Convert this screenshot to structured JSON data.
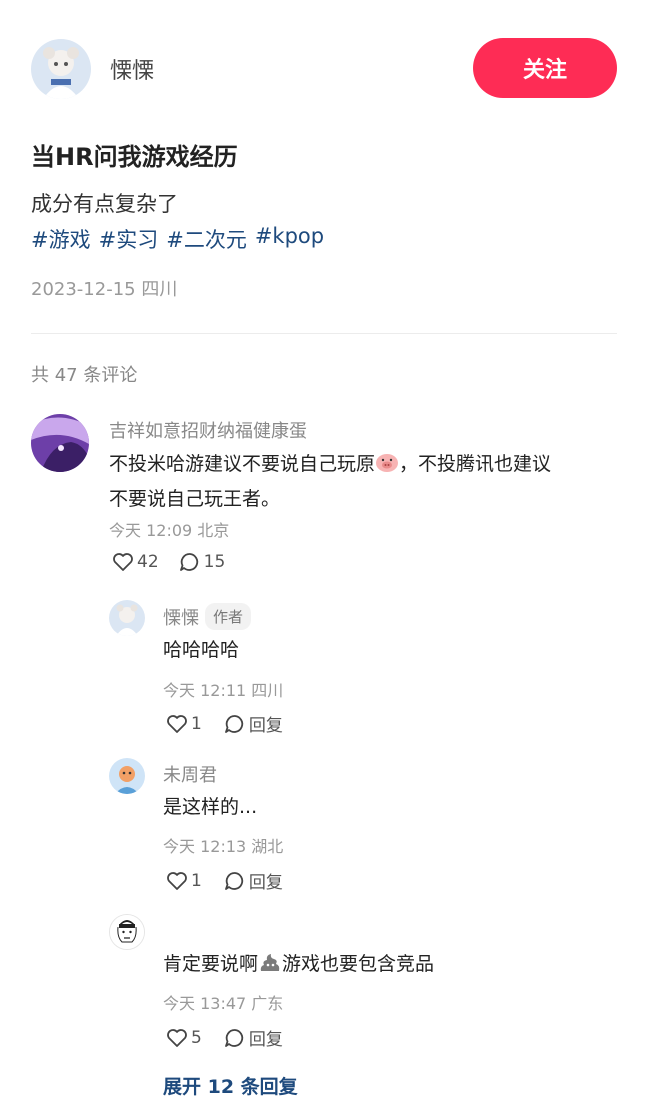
{
  "author": {
    "name": "慄慄"
  },
  "follow_label": "关注",
  "post": {
    "title": "当HR问我游戏经历",
    "body": "成分有点复杂了",
    "tags": [
      "#游戏",
      "#实习",
      "#二次元",
      "#kpop"
    ],
    "meta": "2023-12-15 四川"
  },
  "comment_count": "共 47 条评论",
  "comments": [
    {
      "name": "吉祥如意招财纳福健康蛋",
      "text_a": "不投米哈游建议不要说自己玩原",
      "emoji_a": "pig-emoji",
      "text_b": "，不投腾讯也建议",
      "text_c": "不要说自己玩王者。",
      "meta": "今天 12:09 北京",
      "likes": "42",
      "replies": "15"
    }
  ],
  "replies": [
    {
      "name": "慄慄",
      "badge": "作者",
      "text": "哈哈哈哈",
      "meta": "今天 12:11 四川",
      "likes": "1",
      "reply_label": "回复"
    },
    {
      "name": "未周君",
      "text": "是这样的...",
      "meta": "今天 12:13 湖北",
      "likes": "1",
      "reply_label": "回复"
    },
    {
      "name": "",
      "text_a": "肯定要说啊",
      "emoji": "poop-emoji",
      "text_b": "游戏也要包含竞品",
      "meta": "今天 13:47 广东",
      "likes": "5",
      "reply_label": "回复"
    }
  ],
  "expand_label": "展开 12 条回复",
  "colors": {
    "accent": "#fe2c55",
    "link": "#1e4a7d"
  }
}
